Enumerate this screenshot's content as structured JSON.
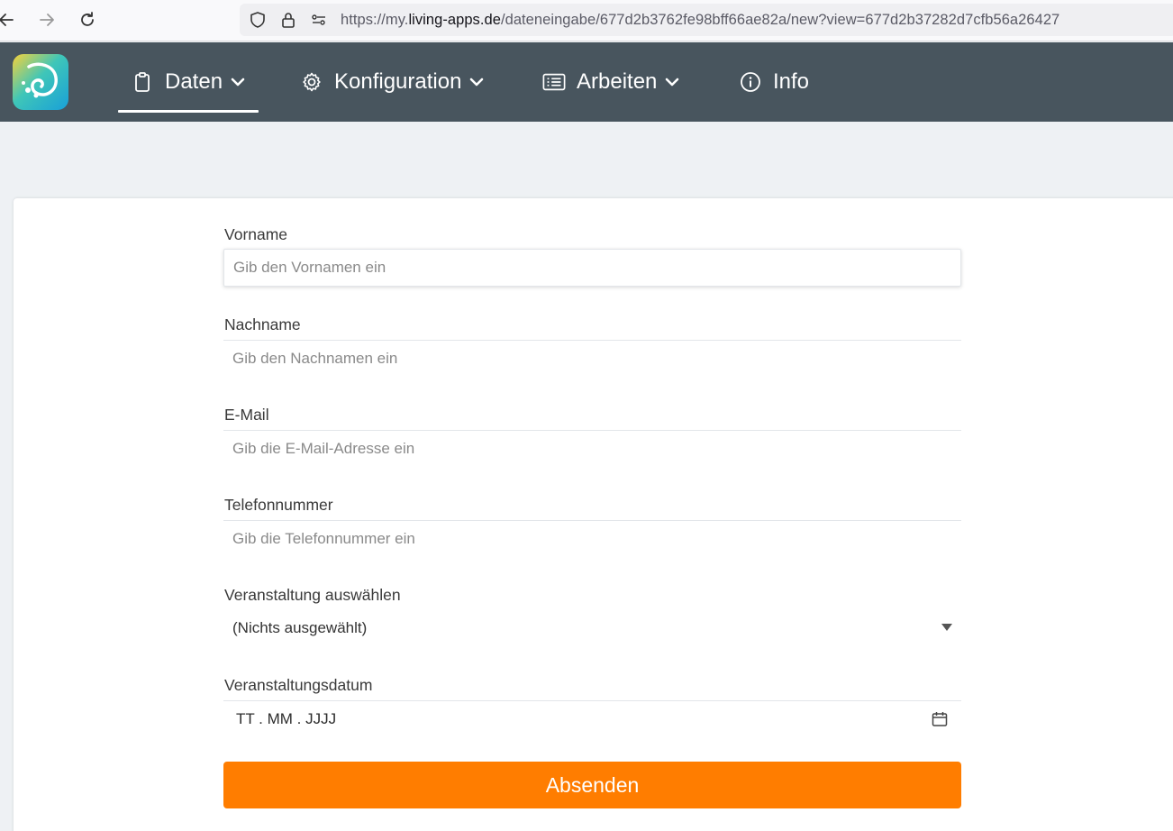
{
  "browser": {
    "url_scheme": "https://my.",
    "url_host": "living-apps.de",
    "url_path": "/dateneingabe/677d2b3762fe98bff66ae82a/new?view=677d2b37282d7cfb56a26427"
  },
  "menu": {
    "items": [
      {
        "label": "Daten",
        "icon": "clipboard-icon"
      },
      {
        "label": "Konfiguration",
        "icon": "gear-icon"
      },
      {
        "label": "Arbeiten",
        "icon": "list-icon"
      },
      {
        "label": "Info",
        "icon": "info-icon"
      }
    ]
  },
  "form": {
    "fields": [
      {
        "label": "Vorname",
        "placeholder": "Gib den Vornamen ein"
      },
      {
        "label": "Nachname",
        "placeholder": "Gib den Nachnamen ein"
      },
      {
        "label": "E-Mail",
        "placeholder": "Gib die E-Mail-Adresse ein"
      },
      {
        "label": "Telefonnummer",
        "placeholder": "Gib die Telefonnummer ein"
      }
    ],
    "select": {
      "label": "Veranstaltung auswählen",
      "value": "(Nichts ausgewählt)"
    },
    "date": {
      "label": "Veranstaltungsdatum",
      "value": "TT . MM . JJJJ"
    },
    "submit_label": "Absenden"
  },
  "colors": {
    "header_bg": "#48555e",
    "submit_bg": "#ff7d00",
    "page_bg": "#eef1f4"
  }
}
